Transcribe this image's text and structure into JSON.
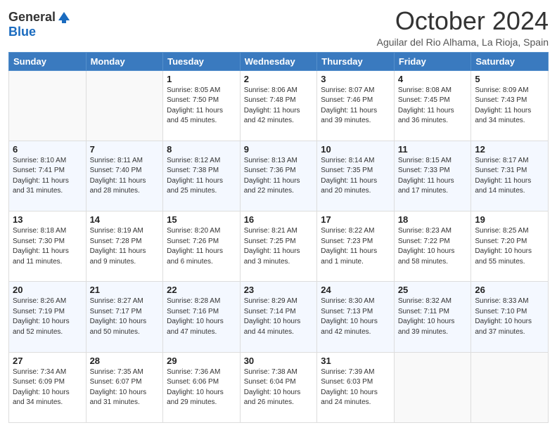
{
  "header": {
    "logo_general": "General",
    "logo_blue": "Blue",
    "month_title": "October 2024",
    "location": "Aguilar del Rio Alhama, La Rioja, Spain"
  },
  "weekdays": [
    "Sunday",
    "Monday",
    "Tuesday",
    "Wednesday",
    "Thursday",
    "Friday",
    "Saturday"
  ],
  "weeks": [
    [
      {
        "day": "",
        "info": ""
      },
      {
        "day": "",
        "info": ""
      },
      {
        "day": "1",
        "info": "Sunrise: 8:05 AM\nSunset: 7:50 PM\nDaylight: 11 hours and 45 minutes."
      },
      {
        "day": "2",
        "info": "Sunrise: 8:06 AM\nSunset: 7:48 PM\nDaylight: 11 hours and 42 minutes."
      },
      {
        "day": "3",
        "info": "Sunrise: 8:07 AM\nSunset: 7:46 PM\nDaylight: 11 hours and 39 minutes."
      },
      {
        "day": "4",
        "info": "Sunrise: 8:08 AM\nSunset: 7:45 PM\nDaylight: 11 hours and 36 minutes."
      },
      {
        "day": "5",
        "info": "Sunrise: 8:09 AM\nSunset: 7:43 PM\nDaylight: 11 hours and 34 minutes."
      }
    ],
    [
      {
        "day": "6",
        "info": "Sunrise: 8:10 AM\nSunset: 7:41 PM\nDaylight: 11 hours and 31 minutes."
      },
      {
        "day": "7",
        "info": "Sunrise: 8:11 AM\nSunset: 7:40 PM\nDaylight: 11 hours and 28 minutes."
      },
      {
        "day": "8",
        "info": "Sunrise: 8:12 AM\nSunset: 7:38 PM\nDaylight: 11 hours and 25 minutes."
      },
      {
        "day": "9",
        "info": "Sunrise: 8:13 AM\nSunset: 7:36 PM\nDaylight: 11 hours and 22 minutes."
      },
      {
        "day": "10",
        "info": "Sunrise: 8:14 AM\nSunset: 7:35 PM\nDaylight: 11 hours and 20 minutes."
      },
      {
        "day": "11",
        "info": "Sunrise: 8:15 AM\nSunset: 7:33 PM\nDaylight: 11 hours and 17 minutes."
      },
      {
        "day": "12",
        "info": "Sunrise: 8:17 AM\nSunset: 7:31 PM\nDaylight: 11 hours and 14 minutes."
      }
    ],
    [
      {
        "day": "13",
        "info": "Sunrise: 8:18 AM\nSunset: 7:30 PM\nDaylight: 11 hours and 11 minutes."
      },
      {
        "day": "14",
        "info": "Sunrise: 8:19 AM\nSunset: 7:28 PM\nDaylight: 11 hours and 9 minutes."
      },
      {
        "day": "15",
        "info": "Sunrise: 8:20 AM\nSunset: 7:26 PM\nDaylight: 11 hours and 6 minutes."
      },
      {
        "day": "16",
        "info": "Sunrise: 8:21 AM\nSunset: 7:25 PM\nDaylight: 11 hours and 3 minutes."
      },
      {
        "day": "17",
        "info": "Sunrise: 8:22 AM\nSunset: 7:23 PM\nDaylight: 11 hours and 1 minute."
      },
      {
        "day": "18",
        "info": "Sunrise: 8:23 AM\nSunset: 7:22 PM\nDaylight: 10 hours and 58 minutes."
      },
      {
        "day": "19",
        "info": "Sunrise: 8:25 AM\nSunset: 7:20 PM\nDaylight: 10 hours and 55 minutes."
      }
    ],
    [
      {
        "day": "20",
        "info": "Sunrise: 8:26 AM\nSunset: 7:19 PM\nDaylight: 10 hours and 52 minutes."
      },
      {
        "day": "21",
        "info": "Sunrise: 8:27 AM\nSunset: 7:17 PM\nDaylight: 10 hours and 50 minutes."
      },
      {
        "day": "22",
        "info": "Sunrise: 8:28 AM\nSunset: 7:16 PM\nDaylight: 10 hours and 47 minutes."
      },
      {
        "day": "23",
        "info": "Sunrise: 8:29 AM\nSunset: 7:14 PM\nDaylight: 10 hours and 44 minutes."
      },
      {
        "day": "24",
        "info": "Sunrise: 8:30 AM\nSunset: 7:13 PM\nDaylight: 10 hours and 42 minutes."
      },
      {
        "day": "25",
        "info": "Sunrise: 8:32 AM\nSunset: 7:11 PM\nDaylight: 10 hours and 39 minutes."
      },
      {
        "day": "26",
        "info": "Sunrise: 8:33 AM\nSunset: 7:10 PM\nDaylight: 10 hours and 37 minutes."
      }
    ],
    [
      {
        "day": "27",
        "info": "Sunrise: 7:34 AM\nSunset: 6:09 PM\nDaylight: 10 hours and 34 minutes."
      },
      {
        "day": "28",
        "info": "Sunrise: 7:35 AM\nSunset: 6:07 PM\nDaylight: 10 hours and 31 minutes."
      },
      {
        "day": "29",
        "info": "Sunrise: 7:36 AM\nSunset: 6:06 PM\nDaylight: 10 hours and 29 minutes."
      },
      {
        "day": "30",
        "info": "Sunrise: 7:38 AM\nSunset: 6:04 PM\nDaylight: 10 hours and 26 minutes."
      },
      {
        "day": "31",
        "info": "Sunrise: 7:39 AM\nSunset: 6:03 PM\nDaylight: 10 hours and 24 minutes."
      },
      {
        "day": "",
        "info": ""
      },
      {
        "day": "",
        "info": ""
      }
    ]
  ]
}
